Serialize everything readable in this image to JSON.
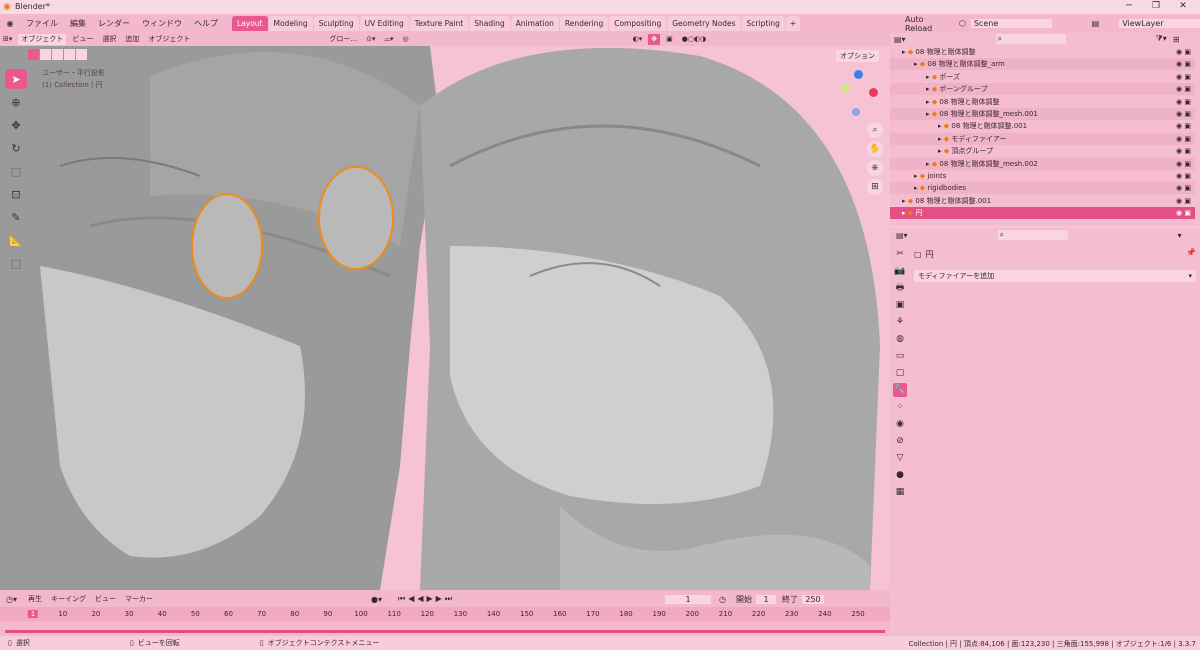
{
  "window": {
    "title": "Blender*"
  },
  "menus": [
    "ファイル",
    "編集",
    "レンダー",
    "ウィンドウ",
    "ヘルプ"
  ],
  "workspace_tabs": [
    "Layout",
    "Modeling",
    "Sculpting",
    "UV Editing",
    "Texture Paint",
    "Shading",
    "Animation",
    "Rendering",
    "Compositing",
    "Geometry Nodes",
    "Scripting"
  ],
  "active_tab": "Layout",
  "topright": {
    "auto_reload": "Auto Reload",
    "scene": "Scene",
    "view_layer": "ViewLayer"
  },
  "viewport_header": {
    "mode": "オブジェクト",
    "items": [
      "ビュー",
      "選択",
      "追加",
      "オブジェクト"
    ],
    "transform": "グロー...",
    "options": "オプション"
  },
  "viewport_info": {
    "line1": "ユーザー・平行投影",
    "line2": "(1) Collection | 円"
  },
  "outliner": {
    "rows": [
      {
        "label": "08 物理と剛体調整",
        "indent": 1
      },
      {
        "label": "08 物理と剛体調整_arm",
        "indent": 2
      },
      {
        "label": "ポーズ",
        "indent": 3
      },
      {
        "label": "ボーングループ",
        "indent": 3
      },
      {
        "label": "08 物理と剛体調整",
        "indent": 3
      },
      {
        "label": "08 物理と剛体調整_mesh.001",
        "indent": 3
      },
      {
        "label": "08 物理と剛体調整.001",
        "indent": 4
      },
      {
        "label": "モディファイアー",
        "indent": 4
      },
      {
        "label": "頂点グループ",
        "indent": 4
      },
      {
        "label": "08 物理と剛体調整_mesh.002",
        "indent": 3
      },
      {
        "label": "joints",
        "indent": 2
      },
      {
        "label": "rigidbodies",
        "indent": 2
      },
      {
        "label": "08 物理と剛体調整.001",
        "indent": 1
      },
      {
        "label": "円",
        "indent": 1
      }
    ]
  },
  "properties": {
    "object_name": "円",
    "add_modifier": "モディファイアーを追加"
  },
  "timeline": {
    "menus": [
      "再生",
      "キーイング",
      "ビュー",
      "マーカー"
    ],
    "current_frame": "1",
    "start_label": "開始",
    "start": "1",
    "end_label": "終了",
    "end": "250",
    "ticks": [
      "1",
      "10",
      "20",
      "30",
      "40",
      "50",
      "60",
      "70",
      "80",
      "90",
      "100",
      "110",
      "120",
      "130",
      "140",
      "150",
      "160",
      "170",
      "180",
      "190",
      "200",
      "210",
      "220",
      "230",
      "240",
      "250"
    ]
  },
  "status": {
    "select": "選択",
    "rotate": "ビューを回転",
    "context": "オブジェクトコンテクストメニュー",
    "stats": "Collection | 円 | 頂点:84,106 | 面:123,230 | 三角面:155,998 | オブジェクト:1/6 | 3.3.7"
  }
}
